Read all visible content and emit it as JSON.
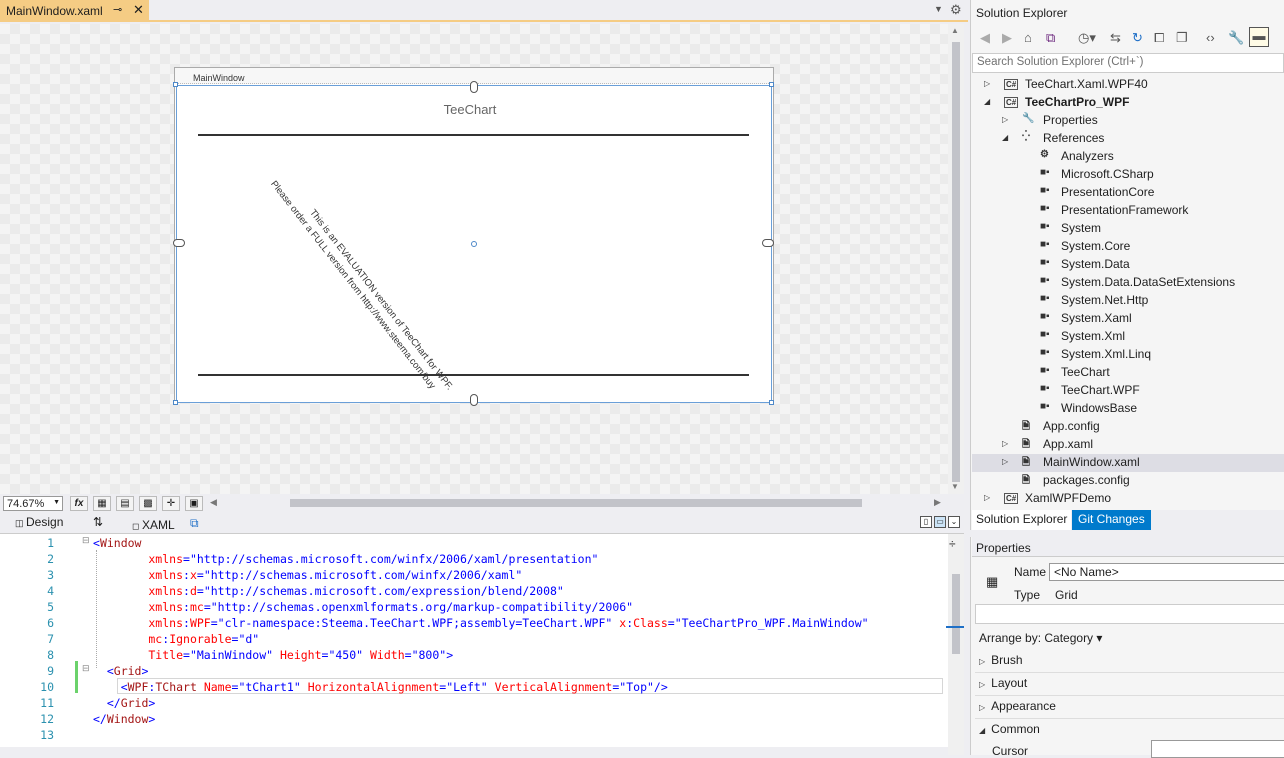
{
  "document_tab": {
    "title": "MainWindow.xaml",
    "pin_glyph": "⊸",
    "close_glyph": "✕"
  },
  "designer": {
    "window_title": "MainWindow",
    "chart_title": "TeeChart",
    "eval_line1": "This is an EVALUATION  version of TeeChart for WPF.",
    "eval_line2": "Please order a FULL version from http://www.steema.com/buy"
  },
  "zoom": {
    "value": "74.67%",
    "fx_label": "fx"
  },
  "view_tabs": {
    "design": "Design",
    "swap": "⇅",
    "xaml": "XAML"
  },
  "code": {
    "line_numbers": [
      "1",
      "2",
      "3",
      "4",
      "5",
      "6",
      "7",
      "8",
      "9",
      "10",
      "11",
      "12",
      "13"
    ],
    "lines": [
      [
        {
          "t": "<",
          "c": "pun"
        },
        {
          "t": "Window",
          "c": "tag"
        }
      ],
      [
        {
          "t": "        xmlns",
          "c": "attr"
        },
        {
          "t": "=",
          "c": "pun"
        },
        {
          "t": "\"http://schemas.microsoft.com/winfx/2006/xaml/presentation\"",
          "c": "val"
        }
      ],
      [
        {
          "t": "        xmlns",
          "c": "attr"
        },
        {
          "t": ":",
          "c": "pun"
        },
        {
          "t": "x",
          "c": "attr"
        },
        {
          "t": "=",
          "c": "pun"
        },
        {
          "t": "\"http://schemas.microsoft.com/winfx/2006/xaml\"",
          "c": "val"
        }
      ],
      [
        {
          "t": "        xmlns",
          "c": "attr"
        },
        {
          "t": ":",
          "c": "pun"
        },
        {
          "t": "d",
          "c": "attr"
        },
        {
          "t": "=",
          "c": "pun"
        },
        {
          "t": "\"http://schemas.microsoft.com/expression/blend/2008\"",
          "c": "val"
        }
      ],
      [
        {
          "t": "        xmlns",
          "c": "attr"
        },
        {
          "t": ":",
          "c": "pun"
        },
        {
          "t": "mc",
          "c": "attr"
        },
        {
          "t": "=",
          "c": "pun"
        },
        {
          "t": "\"http://schemas.openxmlformats.org/markup-compatibility/2006\"",
          "c": "val"
        }
      ],
      [
        {
          "t": "        xmlns",
          "c": "attr"
        },
        {
          "t": ":",
          "c": "pun"
        },
        {
          "t": "WPF",
          "c": "attr"
        },
        {
          "t": "=",
          "c": "pun"
        },
        {
          "t": "\"clr-namespace:Steema.TeeChart.WPF;assembly=TeeChart.WPF\"",
          "c": "val"
        },
        {
          "t": " x",
          "c": "attr"
        },
        {
          "t": ":",
          "c": "pun"
        },
        {
          "t": "Class",
          "c": "attr"
        },
        {
          "t": "=",
          "c": "pun"
        },
        {
          "t": "\"TeeChartPro_WPF.MainWindow\"",
          "c": "val"
        }
      ],
      [
        {
          "t": "        mc",
          "c": "attr"
        },
        {
          "t": ":",
          "c": "pun"
        },
        {
          "t": "Ignorable",
          "c": "attr"
        },
        {
          "t": "=",
          "c": "pun"
        },
        {
          "t": "\"d\"",
          "c": "val"
        }
      ],
      [
        {
          "t": "        Title",
          "c": "attr"
        },
        {
          "t": "=",
          "c": "pun"
        },
        {
          "t": "\"MainWindow\"",
          "c": "val"
        },
        {
          "t": " Height",
          "c": "attr"
        },
        {
          "t": "=",
          "c": "pun"
        },
        {
          "t": "\"450\"",
          "c": "val"
        },
        {
          "t": " Width",
          "c": "attr"
        },
        {
          "t": "=",
          "c": "pun"
        },
        {
          "t": "\"800\"",
          "c": "val"
        },
        {
          "t": ">",
          "c": "pun"
        }
      ],
      [
        {
          "t": "  <",
          "c": "pun"
        },
        {
          "t": "Grid",
          "c": "tag"
        },
        {
          "t": ">",
          "c": "pun"
        }
      ],
      [
        {
          "t": "    <",
          "c": "pun"
        },
        {
          "t": "WPF",
          "c": "tag"
        },
        {
          "t": ":",
          "c": "pun"
        },
        {
          "t": "TChart",
          "c": "tag"
        },
        {
          "t": " Name",
          "c": "attr"
        },
        {
          "t": "=",
          "c": "pun"
        },
        {
          "t": "\"tChart1\"",
          "c": "val"
        },
        {
          "t": " HorizontalAlignment",
          "c": "attr"
        },
        {
          "t": "=",
          "c": "pun"
        },
        {
          "t": "\"Left\"",
          "c": "val"
        },
        {
          "t": " VerticalAlignment",
          "c": "attr"
        },
        {
          "t": "=",
          "c": "pun"
        },
        {
          "t": "\"Top\"",
          "c": "val"
        },
        {
          "t": "/>",
          "c": "pun"
        }
      ],
      [
        {
          "t": "  </",
          "c": "pun"
        },
        {
          "t": "Grid",
          "c": "tag"
        },
        {
          "t": ">",
          "c": "pun"
        }
      ],
      [
        {
          "t": "</",
          "c": "pun"
        },
        {
          "t": "Window",
          "c": "tag"
        },
        {
          "t": ">",
          "c": "pun"
        }
      ],
      [
        {
          "t": "",
          "c": "pun"
        }
      ]
    ]
  },
  "solution_explorer": {
    "title": "Solution Explorer",
    "search_placeholder": "Search Solution Explorer (Ctrl+`)",
    "items": [
      {
        "label": "TeeChart.Xaml.WPF40",
        "icon": "C#",
        "expander": "▷",
        "bold": false
      },
      {
        "label": "TeeChartPro_WPF",
        "icon": "C#",
        "expander": "◢",
        "bold": true
      },
      {
        "label": "Properties",
        "icon": "🔧",
        "expander": "▷",
        "bold": false
      },
      {
        "label": "References",
        "icon": "⁛",
        "expander": "◢",
        "bold": false
      },
      {
        "label": "Analyzers",
        "icon": "⚙",
        "expander": "",
        "bold": false
      },
      {
        "label": "Microsoft.CSharp",
        "icon": "■▪",
        "expander": "",
        "bold": false
      },
      {
        "label": "PresentationCore",
        "icon": "■▪",
        "expander": "",
        "bold": false
      },
      {
        "label": "PresentationFramework",
        "icon": "■▪",
        "expander": "",
        "bold": false
      },
      {
        "label": "System",
        "icon": "■▪",
        "expander": "",
        "bold": false
      },
      {
        "label": "System.Core",
        "icon": "■▪",
        "expander": "",
        "bold": false
      },
      {
        "label": "System.Data",
        "icon": "■▪",
        "expander": "",
        "bold": false
      },
      {
        "label": "System.Data.DataSetExtensions",
        "icon": "■▪",
        "expander": "",
        "bold": false
      },
      {
        "label": "System.Net.Http",
        "icon": "■▪",
        "expander": "",
        "bold": false
      },
      {
        "label": "System.Xaml",
        "icon": "■▪",
        "expander": "",
        "bold": false
      },
      {
        "label": "System.Xml",
        "icon": "■▪",
        "expander": "",
        "bold": false
      },
      {
        "label": "System.Xml.Linq",
        "icon": "■▪",
        "expander": "",
        "bold": false
      },
      {
        "label": "TeeChart",
        "icon": "■▪",
        "expander": "",
        "bold": false
      },
      {
        "label": "TeeChart.WPF",
        "icon": "■▪",
        "expander": "",
        "bold": false
      },
      {
        "label": "WindowsBase",
        "icon": "■▪",
        "expander": "",
        "bold": false
      },
      {
        "label": "App.config",
        "icon": "🗎",
        "expander": "",
        "bold": false
      },
      {
        "label": "App.xaml",
        "icon": "🗎",
        "expander": "▷",
        "bold": false
      },
      {
        "label": "MainWindow.xaml",
        "icon": "🗎",
        "expander": "▷",
        "bold": false
      },
      {
        "label": "packages.config",
        "icon": "🗎",
        "expander": "",
        "bold": false
      },
      {
        "label": "XamlWPFDemo",
        "icon": "C#",
        "expander": "▷",
        "bold": false
      }
    ],
    "tabs": {
      "explorer": "Solution Explorer",
      "git": "Git Changes"
    }
  },
  "properties": {
    "title": "Properties",
    "name_label": "Name",
    "name_value": "<No Name>",
    "type_label": "Type",
    "type_value": "Grid",
    "arrange_by": "Arrange by: Category ▾",
    "categories": [
      "Brush",
      "Layout",
      "Appearance",
      "Common"
    ],
    "cursor_label": "Cursor"
  },
  "colors": {
    "accent": "#007acc",
    "active_tab": "#f5cc84",
    "selection": "#6a9fd8"
  }
}
